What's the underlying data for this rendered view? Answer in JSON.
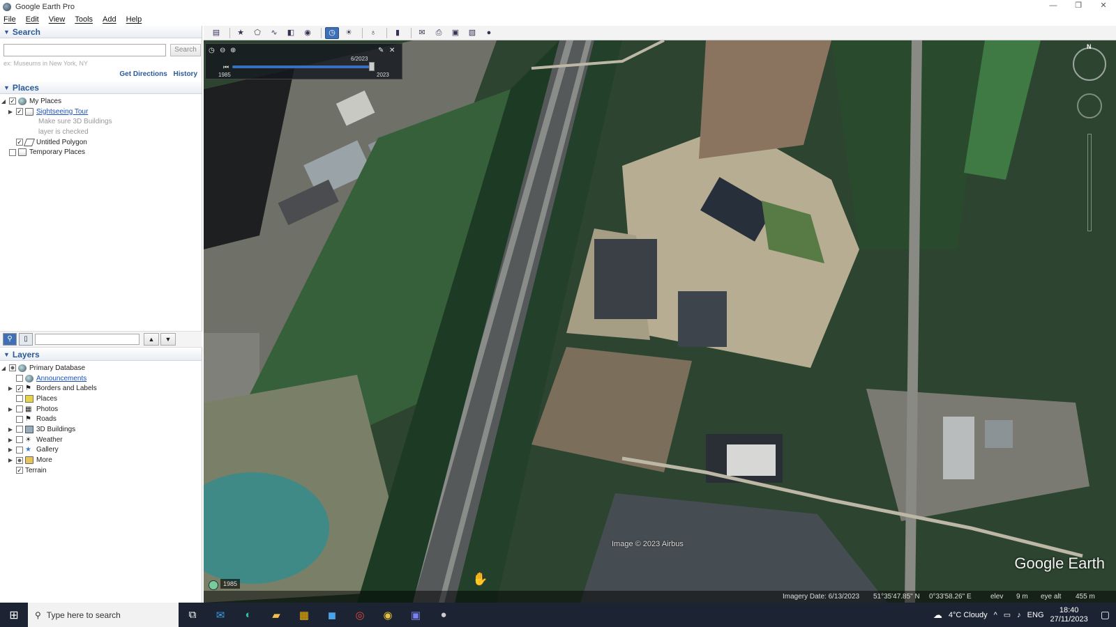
{
  "window": {
    "title": "Google Earth Pro",
    "controls": [
      "—",
      "❐",
      "✕"
    ]
  },
  "menu": [
    "File",
    "Edit",
    "View",
    "Tools",
    "Add",
    "Help"
  ],
  "search": {
    "header": "Search",
    "placeholder": "",
    "button": "Search",
    "hint": "ex: Museums in New York, NY",
    "get_directions": "Get Directions",
    "history": "History"
  },
  "places": {
    "header": "Places",
    "items": [
      {
        "label": "My Places",
        "checked": true,
        "expanded": true
      },
      {
        "label": "Sightseeing Tour",
        "checked": true,
        "link": true
      },
      {
        "note1": "Make sure 3D Buildings",
        "note2": "layer is checked"
      },
      {
        "label": "Untitled Polygon",
        "checked": true
      },
      {
        "label": "Temporary Places",
        "checked": false
      }
    ]
  },
  "layers": {
    "header": "Layers",
    "items": [
      {
        "label": "Primary Database"
      },
      {
        "label": "Announcements"
      },
      {
        "label": "Borders and Labels"
      },
      {
        "label": "Places"
      },
      {
        "label": "Photos"
      },
      {
        "label": "Roads"
      },
      {
        "label": "3D Buildings"
      },
      {
        "label": "Weather"
      },
      {
        "label": "Gallery"
      },
      {
        "label": "More"
      },
      {
        "label": "Terrain"
      }
    ]
  },
  "timeslider": {
    "current": "6/2023",
    "start": "1985",
    "end": "2023",
    "position": 0.97
  },
  "map": {
    "attribution": "Image © 2023 Airbus",
    "logo": "Google Earth",
    "year_badge": "1985",
    "north": "N"
  },
  "status": {
    "imagery_date": "Imagery Date: 6/13/2023",
    "lat": "51°35'47.85\" N",
    "lon": "0°33'58.26\" E",
    "elev_label": "elev",
    "elev": "9 m",
    "eye_label": "eye alt",
    "eye": "455 m"
  },
  "taskbar": {
    "search_text": "Type here to search",
    "weather": "4°C  Cloudy",
    "lang": "ENG",
    "time": "18:40",
    "date": "27/11/2023"
  },
  "colors": {
    "panel_header": "#2a5a9a",
    "link": "#1a4fc0",
    "taskbar": "#1c2433",
    "toolbar_active": "#3f6fb5"
  }
}
